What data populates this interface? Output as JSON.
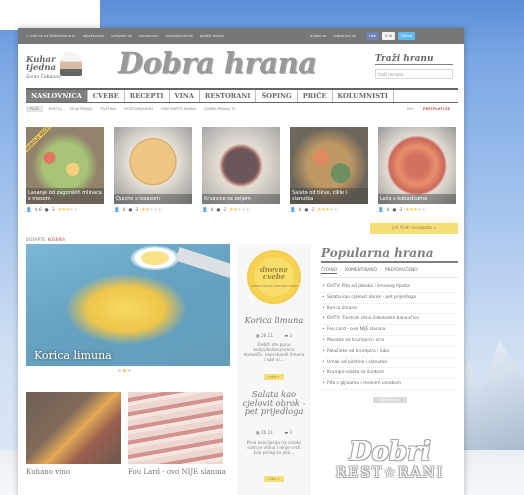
{
  "topbar": {
    "links": [
      "» vrati se na Dobrahrana.hr",
      "oglašavanje",
      "pretplati se",
      "impressum",
      "kontakt/pravila",
      "pošalji recept"
    ],
    "right_links": [
      "prijavi se",
      "registriraj se"
    ],
    "social": [
      "Like",
      "0 fb",
      "Follow"
    ]
  },
  "header": {
    "kuhar_line1": "Kuhar",
    "kuhar_line2": "tjedna",
    "kuhar_name": "Zoran Čobanov",
    "logo": "Dobra hrana",
    "search_label": "Traži hranu",
    "search_placeholder": "traži recepte"
  },
  "nav": {
    "items": [
      "NASLOVNICA",
      "CVEBE",
      "RECEPTI",
      "VINA",
      "RESTORANI",
      "ŠOPING",
      "PRIČE",
      "KOLUMNISTI"
    ],
    "active_index": 0
  },
  "subnav": {
    "plus": "PLUS",
    "items": [
      "KOŠTILJ",
      "MOJA ŠPAJZA",
      "PILETINA",
      "VEGETARIJANSKI",
      "GDJE KAFETI HRANA",
      "DOBRA HRANA TV"
    ],
    "subscribe_prefix": "DH:",
    "subscribe_label": "PRETPLATI SE"
  },
  "cards": [
    {
      "title": "Lasanje od zagorskih mlinaca s mesom",
      "users": "4·6",
      "comments": "3",
      "rating": 3,
      "ribbon": "NAJBOLJI RECEPTI"
    },
    {
      "title": "Quiche s lososom",
      "users": "4",
      "comments": "3",
      "rating": 2
    },
    {
      "title": "Krvavice sa zeljem",
      "users": "4",
      "comments": "2",
      "rating": 2
    },
    {
      "title": "Salata od tikve, cikle i slanutka",
      "users": "4",
      "comments": "2",
      "rating": 3
    },
    {
      "title": "Lečo s kobasicama",
      "users": "4",
      "comments": "3",
      "rating": 3
    }
  ],
  "more_recipes": "još finih recepata »",
  "featured": {
    "tag_prefix": "DOŠAPTE:",
    "tag_label": "KOŠNIKA",
    "title": "Korica limuna"
  },
  "thumbs": [
    {
      "caption": "Kuhano vino"
    },
    {
      "caption": "Fou Lard - ovo NIJE slanina"
    }
  ],
  "midcol": {
    "badge_line1": "dnevne",
    "badge_line2": "cvebe",
    "badge_sub": "DOBRA HRANA DNEVNE CVEBE",
    "items": [
      {
        "title": "Korica limuna",
        "date": "26.11.",
        "comments": "2",
        "text": "Dobiti ste punu kutiju/košaru/vreću domaćih, neprskanih limuna i sad ni...",
        "more": "više »"
      },
      {
        "title": "Salata kao cjelovit obrok - pet prijedloga",
        "date": "26.11.",
        "comments": "3",
        "text": "Prva asocijacija na salatu nam je vitina i lenje vrsti kao prilog za jela...",
        "more": "više »"
      }
    ]
  },
  "popular": {
    "title": "Popularna hrana",
    "tabs": [
      "ČITANO",
      "KOMENTIRANO",
      "PREPORUČENO"
    ],
    "items": [
      "DHTV: Pita od jabuka i limunog tijesta",
      "Salata kao cjelovit obrok - pet prijedloga",
      "Korica limuna",
      "DHTV: Tiestrali sitno čokoladne banančice",
      "Fou Lard - ovo NIJE slanina",
      "Musaka od krumpira i sira",
      "Palačinke od krumpira i luka",
      "Umak od piletine i slanutka",
      "Krumpir-salata sa šunkom",
      "Pita s gljivama i mesnim umakom"
    ],
    "more": "ARHIVA »"
  },
  "bottom_logo": {
    "line1": "Dobri",
    "line2": "REST☆RANI"
  },
  "colors": {
    "accent_yellow": "#f2d64a",
    "nav_active": "#555555",
    "brand_red": "#b02020"
  }
}
